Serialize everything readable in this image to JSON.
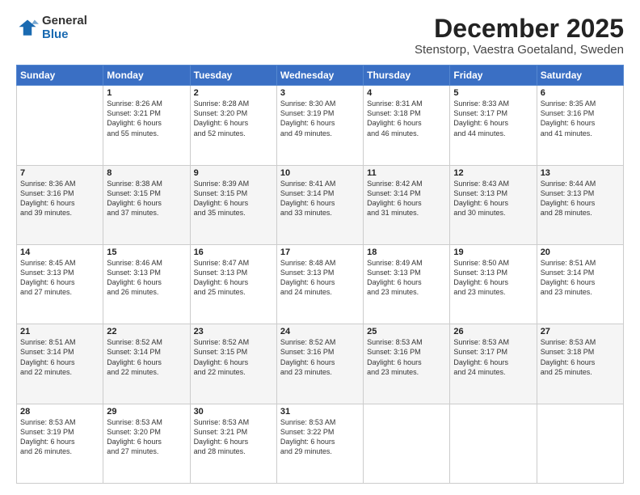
{
  "logo": {
    "general": "General",
    "blue": "Blue"
  },
  "title": "December 2025",
  "subtitle": "Stenstorp, Vaestra Goetaland, Sweden",
  "days": [
    "Sunday",
    "Monday",
    "Tuesday",
    "Wednesday",
    "Thursday",
    "Friday",
    "Saturday"
  ],
  "weeks": [
    [
      {
        "date": "",
        "sunrise": "",
        "sunset": "",
        "daylight": ""
      },
      {
        "date": "1",
        "sunrise": "Sunrise: 8:26 AM",
        "sunset": "Sunset: 3:21 PM",
        "daylight": "Daylight: 6 hours and 55 minutes."
      },
      {
        "date": "2",
        "sunrise": "Sunrise: 8:28 AM",
        "sunset": "Sunset: 3:20 PM",
        "daylight": "Daylight: 6 hours and 52 minutes."
      },
      {
        "date": "3",
        "sunrise": "Sunrise: 8:30 AM",
        "sunset": "Sunset: 3:19 PM",
        "daylight": "Daylight: 6 hours and 49 minutes."
      },
      {
        "date": "4",
        "sunrise": "Sunrise: 8:31 AM",
        "sunset": "Sunset: 3:18 PM",
        "daylight": "Daylight: 6 hours and 46 minutes."
      },
      {
        "date": "5",
        "sunrise": "Sunrise: 8:33 AM",
        "sunset": "Sunset: 3:17 PM",
        "daylight": "Daylight: 6 hours and 44 minutes."
      },
      {
        "date": "6",
        "sunrise": "Sunrise: 8:35 AM",
        "sunset": "Sunset: 3:16 PM",
        "daylight": "Daylight: 6 hours and 41 minutes."
      }
    ],
    [
      {
        "date": "7",
        "sunrise": "Sunrise: 8:36 AM",
        "sunset": "Sunset: 3:16 PM",
        "daylight": "Daylight: 6 hours and 39 minutes."
      },
      {
        "date": "8",
        "sunrise": "Sunrise: 8:38 AM",
        "sunset": "Sunset: 3:15 PM",
        "daylight": "Daylight: 6 hours and 37 minutes."
      },
      {
        "date": "9",
        "sunrise": "Sunrise: 8:39 AM",
        "sunset": "Sunset: 3:15 PM",
        "daylight": "Daylight: 6 hours and 35 minutes."
      },
      {
        "date": "10",
        "sunrise": "Sunrise: 8:41 AM",
        "sunset": "Sunset: 3:14 PM",
        "daylight": "Daylight: 6 hours and 33 minutes."
      },
      {
        "date": "11",
        "sunrise": "Sunrise: 8:42 AM",
        "sunset": "Sunset: 3:14 PM",
        "daylight": "Daylight: 6 hours and 31 minutes."
      },
      {
        "date": "12",
        "sunrise": "Sunrise: 8:43 AM",
        "sunset": "Sunset: 3:13 PM",
        "daylight": "Daylight: 6 hours and 30 minutes."
      },
      {
        "date": "13",
        "sunrise": "Sunrise: 8:44 AM",
        "sunset": "Sunset: 3:13 PM",
        "daylight": "Daylight: 6 hours and 28 minutes."
      }
    ],
    [
      {
        "date": "14",
        "sunrise": "Sunrise: 8:45 AM",
        "sunset": "Sunset: 3:13 PM",
        "daylight": "Daylight: 6 hours and 27 minutes."
      },
      {
        "date": "15",
        "sunrise": "Sunrise: 8:46 AM",
        "sunset": "Sunset: 3:13 PM",
        "daylight": "Daylight: 6 hours and 26 minutes."
      },
      {
        "date": "16",
        "sunrise": "Sunrise: 8:47 AM",
        "sunset": "Sunset: 3:13 PM",
        "daylight": "Daylight: 6 hours and 25 minutes."
      },
      {
        "date": "17",
        "sunrise": "Sunrise: 8:48 AM",
        "sunset": "Sunset: 3:13 PM",
        "daylight": "Daylight: 6 hours and 24 minutes."
      },
      {
        "date": "18",
        "sunrise": "Sunrise: 8:49 AM",
        "sunset": "Sunset: 3:13 PM",
        "daylight": "Daylight: 6 hours and 23 minutes."
      },
      {
        "date": "19",
        "sunrise": "Sunrise: 8:50 AM",
        "sunset": "Sunset: 3:13 PM",
        "daylight": "Daylight: 6 hours and 23 minutes."
      },
      {
        "date": "20",
        "sunrise": "Sunrise: 8:51 AM",
        "sunset": "Sunset: 3:14 PM",
        "daylight": "Daylight: 6 hours and 23 minutes."
      }
    ],
    [
      {
        "date": "21",
        "sunrise": "Sunrise: 8:51 AM",
        "sunset": "Sunset: 3:14 PM",
        "daylight": "Daylight: 6 hours and 22 minutes."
      },
      {
        "date": "22",
        "sunrise": "Sunrise: 8:52 AM",
        "sunset": "Sunset: 3:14 PM",
        "daylight": "Daylight: 6 hours and 22 minutes."
      },
      {
        "date": "23",
        "sunrise": "Sunrise: 8:52 AM",
        "sunset": "Sunset: 3:15 PM",
        "daylight": "Daylight: 6 hours and 22 minutes."
      },
      {
        "date": "24",
        "sunrise": "Sunrise: 8:52 AM",
        "sunset": "Sunset: 3:16 PM",
        "daylight": "Daylight: 6 hours and 23 minutes."
      },
      {
        "date": "25",
        "sunrise": "Sunrise: 8:53 AM",
        "sunset": "Sunset: 3:16 PM",
        "daylight": "Daylight: 6 hours and 23 minutes."
      },
      {
        "date": "26",
        "sunrise": "Sunrise: 8:53 AM",
        "sunset": "Sunset: 3:17 PM",
        "daylight": "Daylight: 6 hours and 24 minutes."
      },
      {
        "date": "27",
        "sunrise": "Sunrise: 8:53 AM",
        "sunset": "Sunset: 3:18 PM",
        "daylight": "Daylight: 6 hours and 25 minutes."
      }
    ],
    [
      {
        "date": "28",
        "sunrise": "Sunrise: 8:53 AM",
        "sunset": "Sunset: 3:19 PM",
        "daylight": "Daylight: 6 hours and 26 minutes."
      },
      {
        "date": "29",
        "sunrise": "Sunrise: 8:53 AM",
        "sunset": "Sunset: 3:20 PM",
        "daylight": "Daylight: 6 hours and 27 minutes."
      },
      {
        "date": "30",
        "sunrise": "Sunrise: 8:53 AM",
        "sunset": "Sunset: 3:21 PM",
        "daylight": "Daylight: 6 hours and 28 minutes."
      },
      {
        "date": "31",
        "sunrise": "Sunrise: 8:53 AM",
        "sunset": "Sunset: 3:22 PM",
        "daylight": "Daylight: 6 hours and 29 minutes."
      },
      {
        "date": "",
        "sunrise": "",
        "sunset": "",
        "daylight": ""
      },
      {
        "date": "",
        "sunrise": "",
        "sunset": "",
        "daylight": ""
      },
      {
        "date": "",
        "sunrise": "",
        "sunset": "",
        "daylight": ""
      }
    ]
  ]
}
